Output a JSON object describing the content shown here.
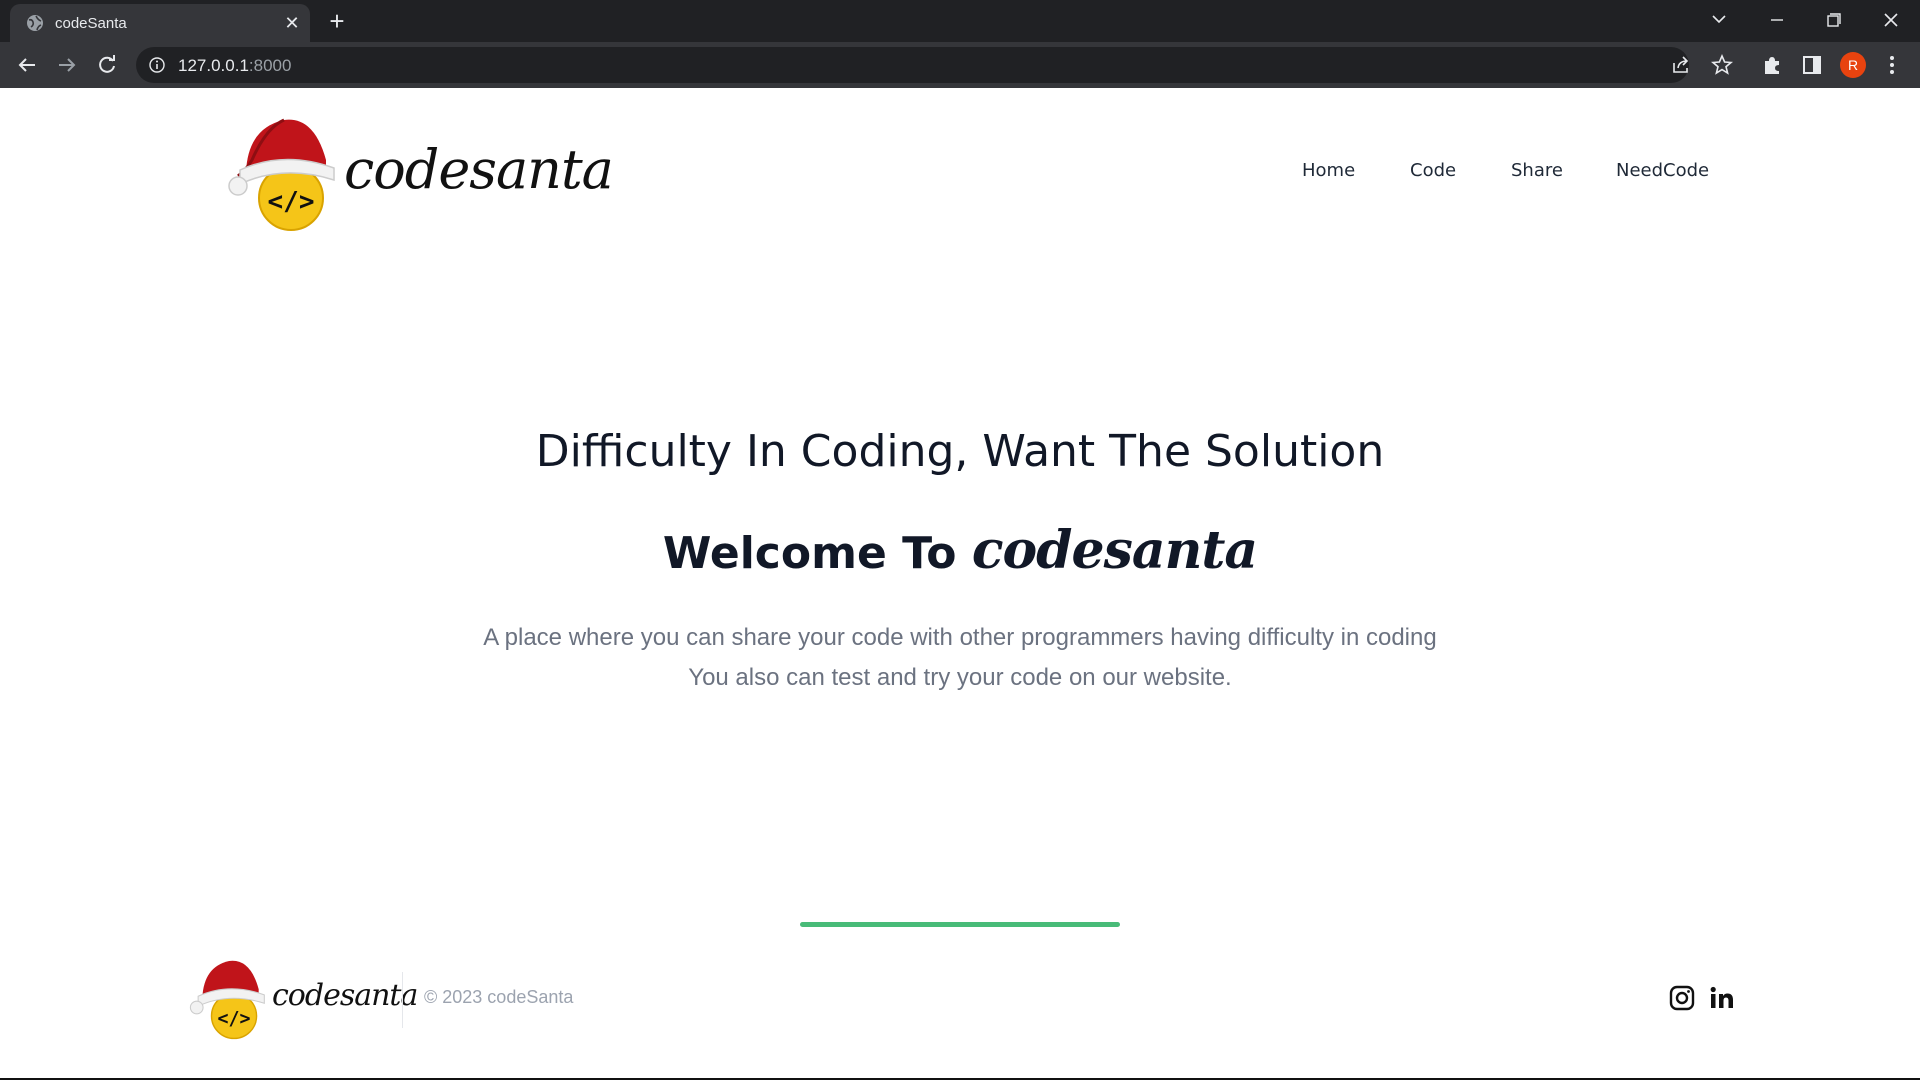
{
  "browser": {
    "tab_title": "codeSanta",
    "url_host": "127.0.0.1",
    "url_port": ":8000",
    "profile_initial": "R"
  },
  "header": {
    "brand": "codesanta",
    "nav": [
      {
        "label": "Home"
      },
      {
        "label": "Code"
      },
      {
        "label": "Share"
      },
      {
        "label": "NeedCode"
      }
    ]
  },
  "hero": {
    "title": "Difficulty In Coding, Want The Solution",
    "welcome_prefix": "Welcome To ",
    "welcome_brand": "codesanta",
    "desc_line1": "A place where you can share your code with other programmers having difficulty in coding",
    "desc_line2": "You also can test and try your code on our website."
  },
  "footer": {
    "brand": "codesanta",
    "copyright": "© 2023 codeSanta"
  },
  "colors": {
    "accent_bar": "#48bb78",
    "chrome_dark": "#202124",
    "chrome_toolbar": "#35363a",
    "profile": "#e8430f"
  },
  "icons": [
    "globe-icon",
    "close-icon",
    "plus-icon",
    "chevron-down-icon",
    "minimize-icon",
    "restore-icon",
    "window-close-icon",
    "back-icon",
    "forward-icon",
    "reload-icon",
    "info-icon",
    "share-icon",
    "star-icon",
    "extensions-icon",
    "sidepanel-icon",
    "menu-icon",
    "santa-logo-icon",
    "instagram-icon",
    "linkedin-icon"
  ]
}
